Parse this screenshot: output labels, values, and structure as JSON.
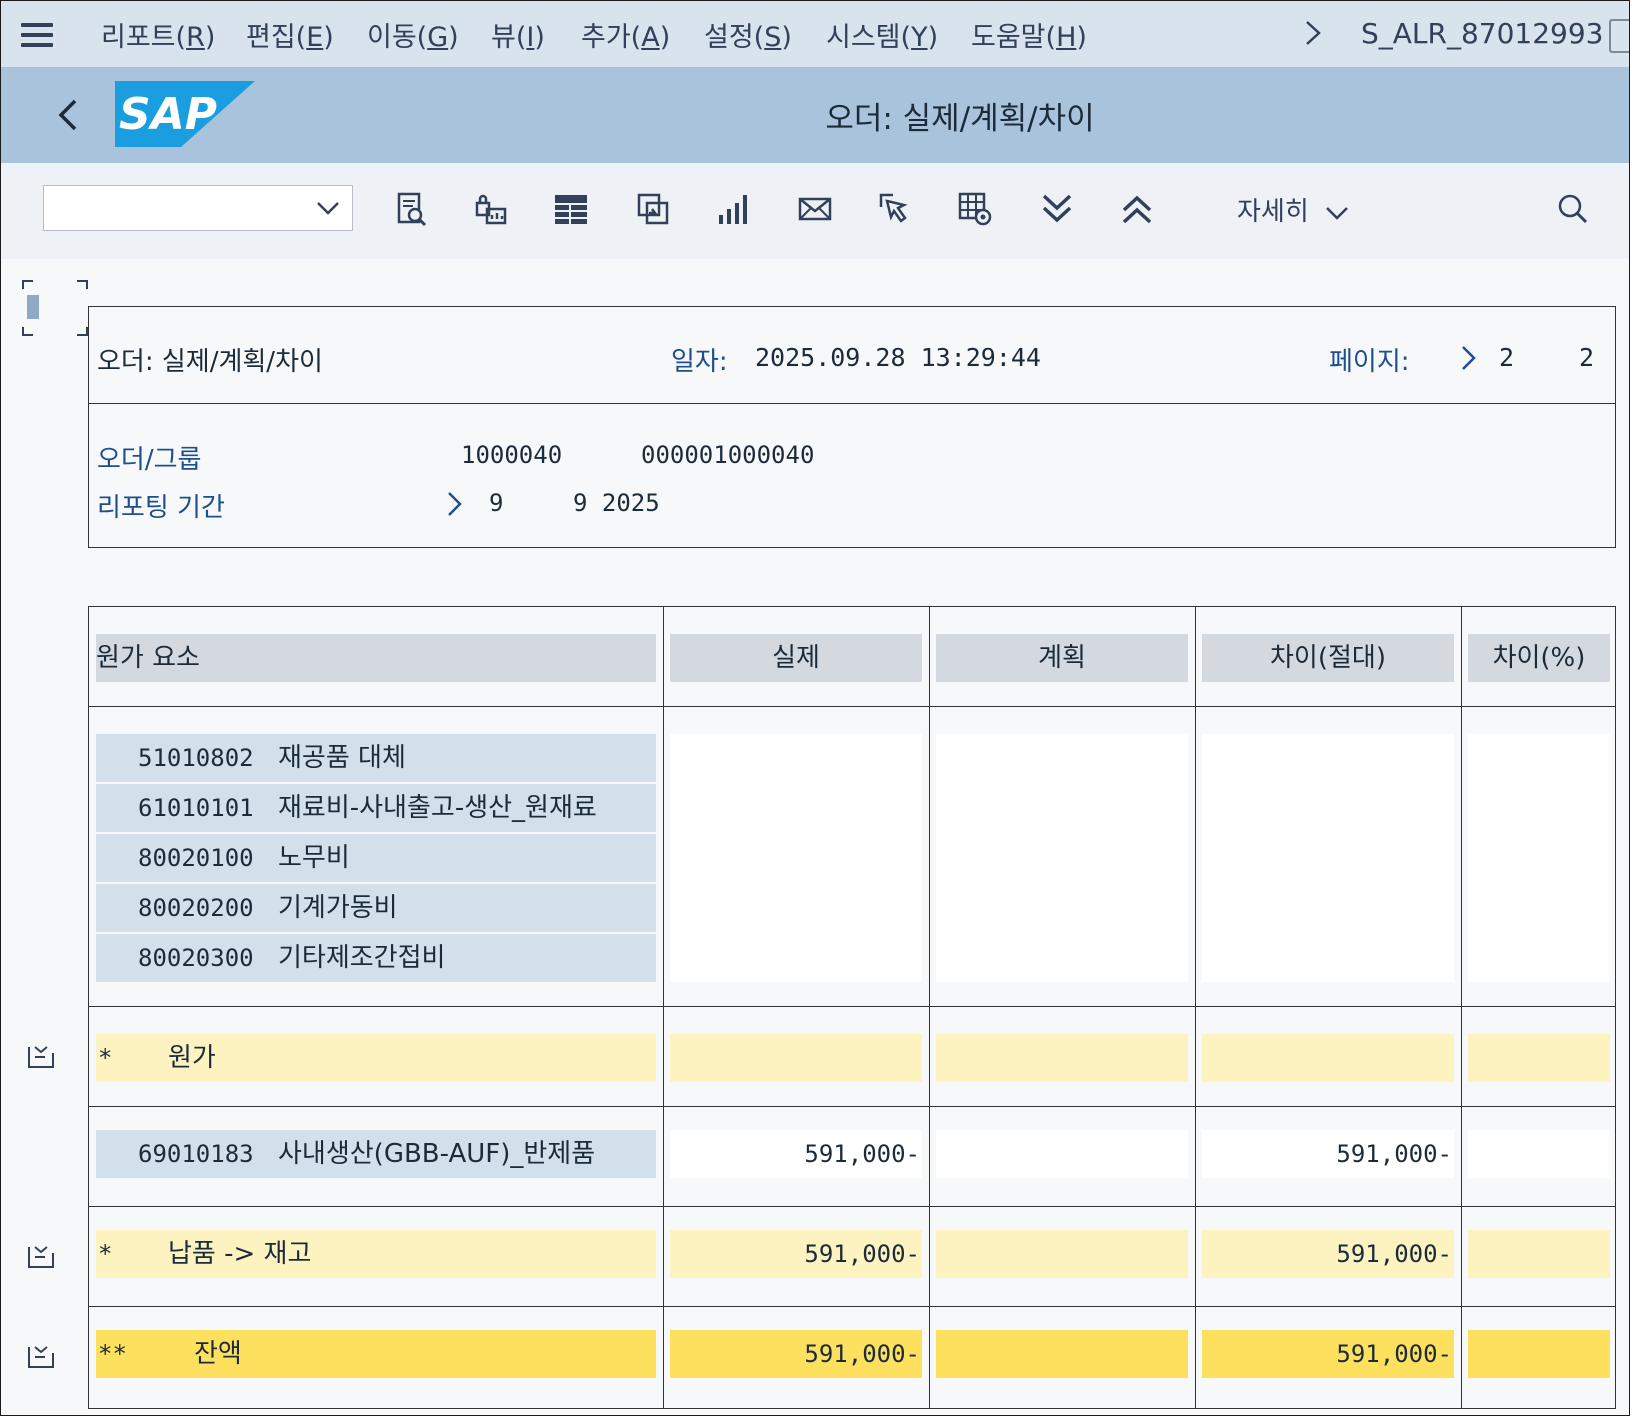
{
  "menubar": {
    "items": [
      {
        "label": "리포트(",
        "key": "R",
        "end": ")"
      },
      {
        "label": "편집(",
        "key": "E",
        "end": ")"
      },
      {
        "label": "이동(",
        "key": "G",
        "end": ")"
      },
      {
        "label": "뷰(",
        "key": "I",
        "end": ")"
      },
      {
        "label": "추가(",
        "key": "A",
        "end": ")"
      },
      {
        "label": "설정(",
        "key": "S",
        "end": ")"
      },
      {
        "label": "시스템(",
        "key": "Y",
        "end": ")"
      },
      {
        "label": "도움말(",
        "key": "H",
        "end": ")"
      }
    ],
    "tcode": "S_ALR_87012993"
  },
  "titlebar": {
    "logo_text": "SAP",
    "title": "오더: 실제/계획/차이"
  },
  "toolbar": {
    "dropdown_value": "",
    "details_label": "자세히",
    "icons": [
      "report-detail-icon",
      "lock-chart-icon",
      "table-layout-icon",
      "export-icon",
      "bar-chart-icon",
      "mail-icon",
      "select-pointer-icon",
      "grid-settings-icon",
      "expand-all-icon",
      "collapse-all-icon"
    ]
  },
  "report": {
    "header": {
      "title": "오더: 실제/계획/차이",
      "date_label": "일자:",
      "date": "2025.09.28 13:29:44",
      "page_label": "페이지:",
      "page_current": "2",
      "page_total": "2",
      "order_label": "오더/그룹",
      "order_number": "1000040",
      "order_group": "000001000040",
      "period_label": "리포팅 기간",
      "period_from": "9",
      "period_to": "9 2025"
    },
    "columns": [
      "원가 요소",
      "실제",
      "계획",
      "차이(절대)",
      "차이(%)"
    ],
    "cost_elements": [
      {
        "code": "51010802",
        "name": "재공품 대체"
      },
      {
        "code": "61010101",
        "name": "재료비-사내출고-생산_원재료"
      },
      {
        "code": "80020100",
        "name": "노무비"
      },
      {
        "code": "80020200",
        "name": "기계가동비"
      },
      {
        "code": "80020300",
        "name": "기타제조간접비"
      }
    ],
    "subtotal_cost": {
      "stars": "*",
      "label": "원가",
      "actual": "",
      "plan": "",
      "var_abs": "",
      "var_pct": ""
    },
    "delivery_element": {
      "code": "69010183",
      "name": "사내생산(GBB-AUF)_반제품",
      "actual": "591,000-",
      "plan": "",
      "var_abs": "591,000-",
      "var_pct": ""
    },
    "subtotal_delivery": {
      "stars": "*",
      "label": "납품 -> 재고",
      "actual": "591,000-",
      "plan": "",
      "var_abs": "591,000-",
      "var_pct": ""
    },
    "balance": {
      "stars": "**",
      "label": "잔액",
      "actual": "591,000-",
      "plan": "",
      "var_abs": "591,000-",
      "var_pct": ""
    }
  },
  "colors": {
    "menubar": "#d8e3ee",
    "titlebar": "#a9c3dc",
    "sap_blue": "#1a9ee0",
    "element_row": "#d2e0ec",
    "subtotal_row": "#fdf3c1",
    "balance_row": "#fde05e"
  }
}
